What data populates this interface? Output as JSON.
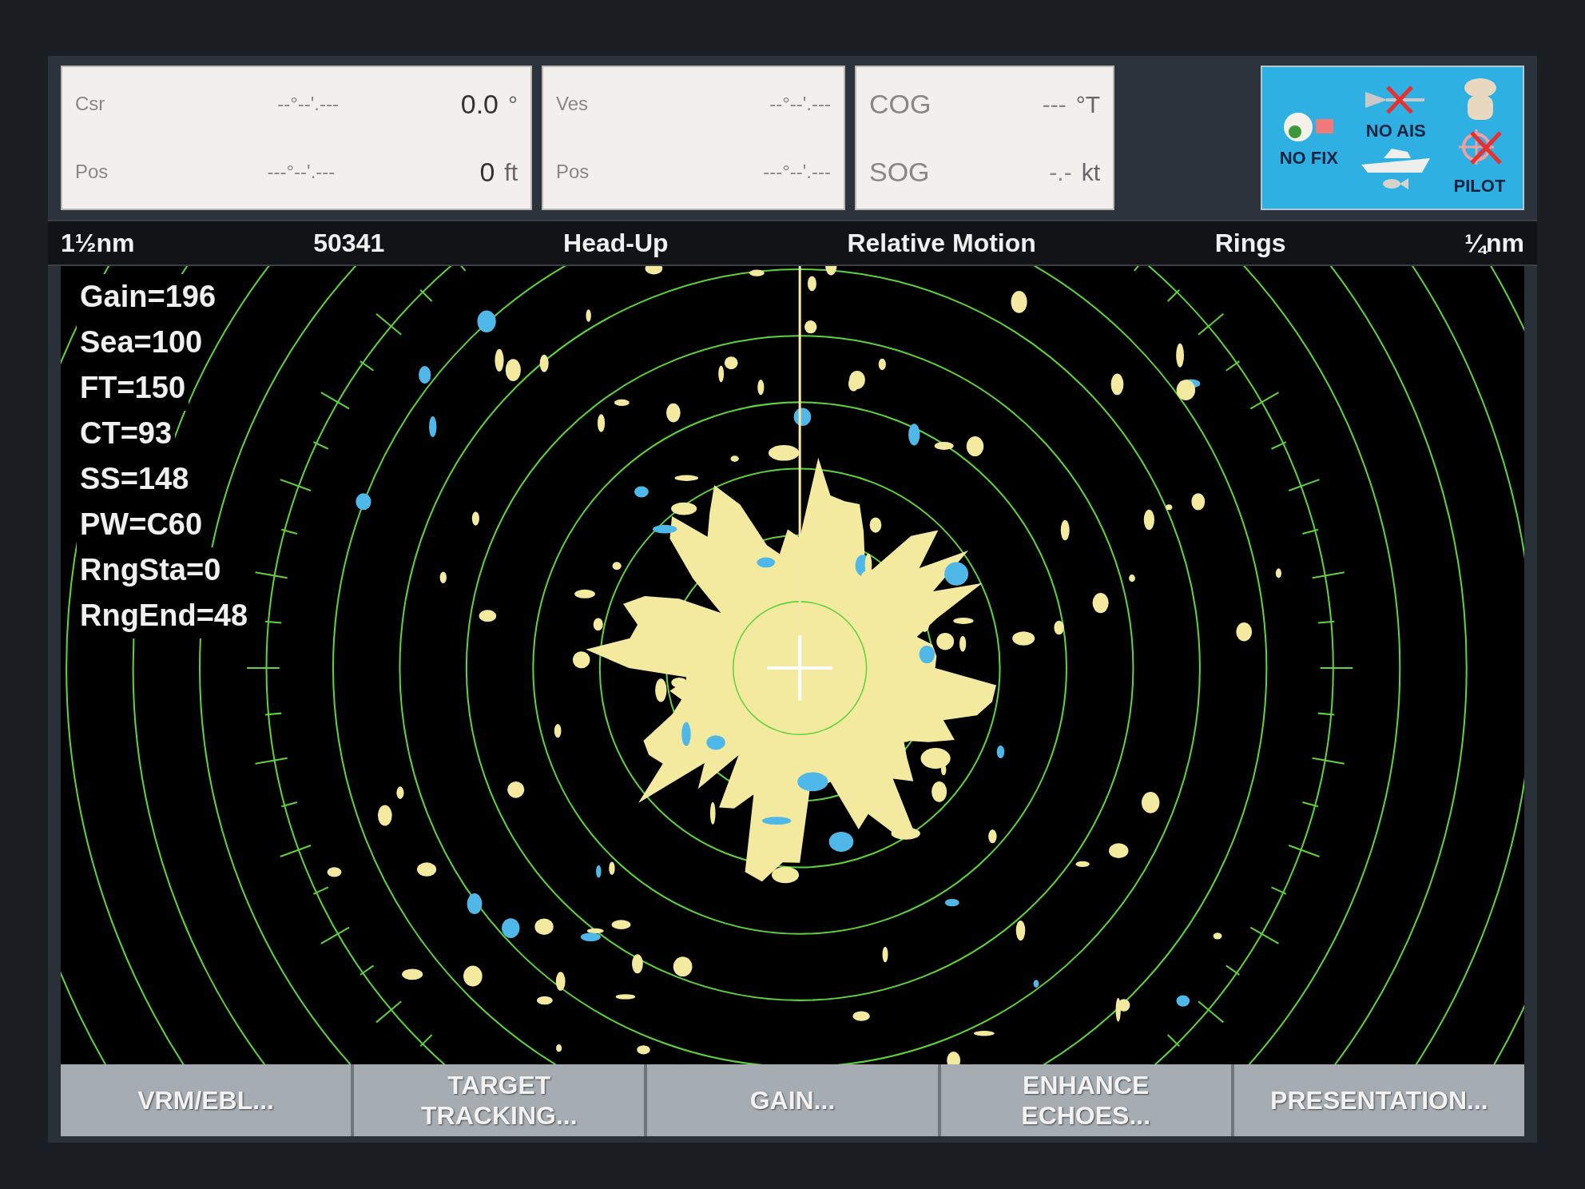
{
  "data_boxes": [
    {
      "rows": [
        {
          "label": "Csr",
          "value": "--°--'.---",
          "reading": "0.0",
          "unit": "°"
        },
        {
          "label": "Pos",
          "value": "---°--'.---",
          "reading": "0",
          "unit": "ft"
        }
      ]
    },
    {
      "rows": [
        {
          "label": "Ves",
          "value": "--°--'.---"
        },
        {
          "label": "Pos",
          "value": "---°--'.---"
        }
      ]
    },
    {
      "rows": [
        {
          "label": "COG",
          "value": "---",
          "unit": "°T"
        },
        {
          "label": "SOG",
          "value": "-.-",
          "unit": "kt"
        }
      ]
    }
  ],
  "status_panel": {
    "no_fix": "NO FIX",
    "no_ais": "NO AIS",
    "pilot": "PILOT"
  },
  "status_bar": [
    "1½nm",
    "50341",
    "Head-Up",
    "Relative Motion",
    "Rings",
    "¼nm"
  ],
  "readouts": [
    "Gain=196",
    "Sea=100",
    "FT=150",
    "CT=93",
    "SS=148",
    "PW=C60",
    "RngSta=0",
    "RngEnd=48"
  ],
  "softkeys": [
    "VRM/EBL...",
    "TARGET\nTRACKING...",
    "GAIN...",
    "ENHANCE\nECHOES...",
    "PRESENTATION..."
  ]
}
